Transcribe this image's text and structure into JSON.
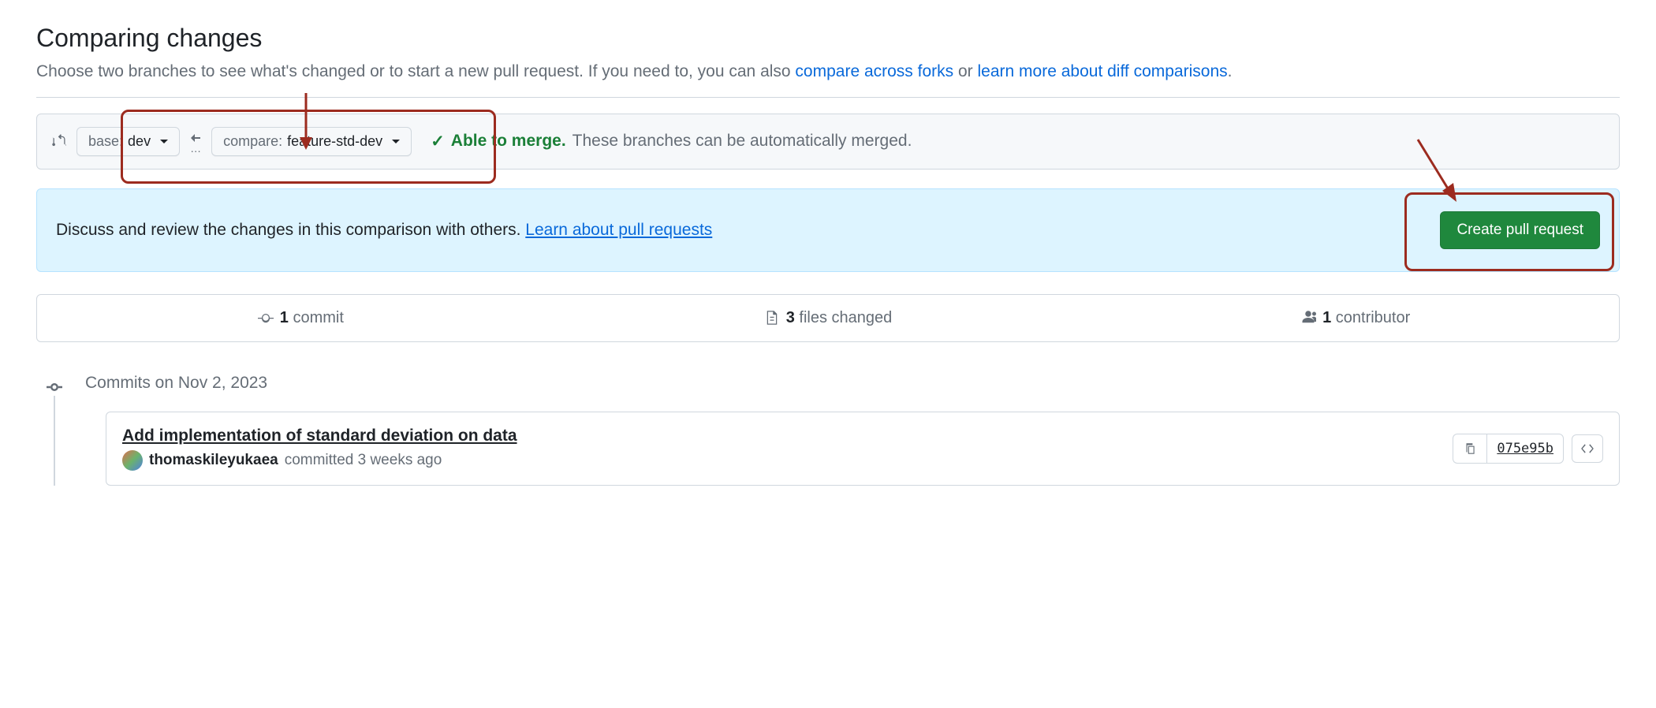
{
  "header": {
    "title": "Comparing changes",
    "subtitle_pre": "Choose two branches to see what's changed or to start a new pull request. If you need to, you can also ",
    "link_compare_forks": "compare across forks",
    "subtitle_mid": " or ",
    "link_diff": "learn more about diff comparisons",
    "subtitle_end": "."
  },
  "range": {
    "base_label": "base:",
    "base_value": "dev",
    "compare_label": "compare:",
    "compare_value": "feature-std-dev",
    "able_label": "Able to merge.",
    "able_rest": "These branches can be automatically merged."
  },
  "discuss": {
    "text": "Discuss and review the changes in this comparison with others. ",
    "link": "Learn about pull requests",
    "button": "Create pull request"
  },
  "stats": {
    "commits_n": "1",
    "commits_label": "commit",
    "files_n": "3",
    "files_label": "files changed",
    "contrib_n": "1",
    "contrib_label": "contributor"
  },
  "timeline": {
    "date_label": "Commits on Nov 2, 2023"
  },
  "commit": {
    "title": "Add implementation of standard deviation on data",
    "author": "thomaskileyukaea",
    "committed": "committed 3 weeks ago",
    "sha": "075e95b"
  }
}
